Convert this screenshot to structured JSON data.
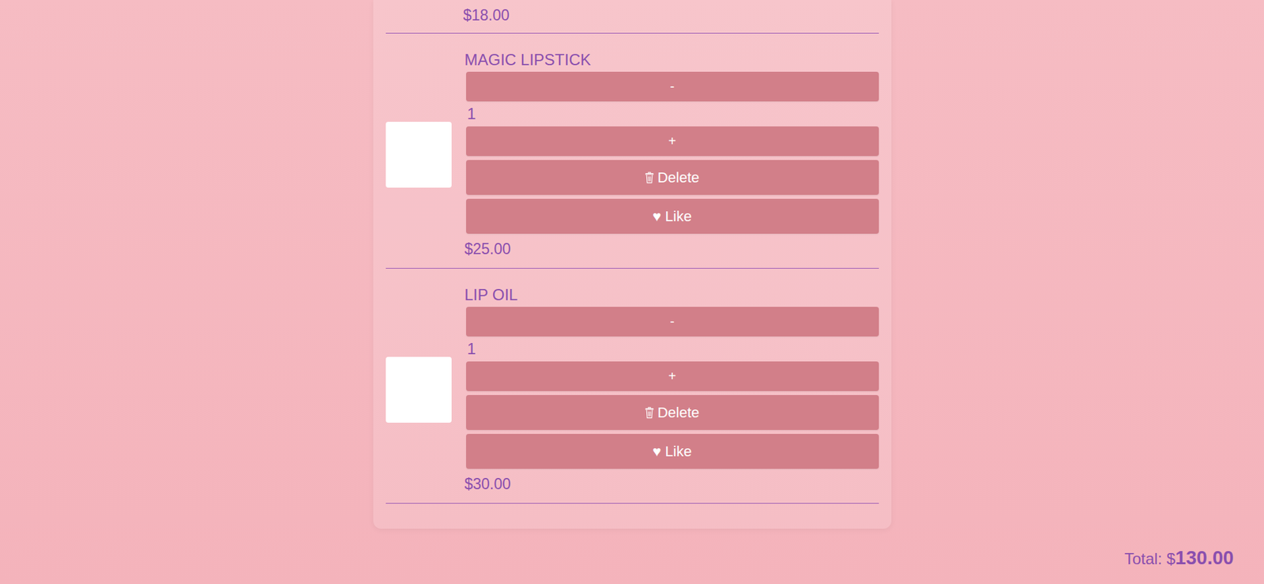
{
  "cart": {
    "partial_item": {
      "price": "$18.00"
    },
    "items": [
      {
        "name": "MAGIC LIPSTICK",
        "decrement": "-",
        "quantity": "1",
        "increment": "+",
        "delete": "Delete",
        "like_icon": "♥",
        "like": "Like",
        "price": "$25.00"
      },
      {
        "name": "LIP OIL",
        "decrement": "-",
        "quantity": "1",
        "increment": "+",
        "delete": "Delete",
        "like_icon": "♥",
        "like": "Like",
        "price": "$30.00"
      }
    ]
  },
  "total": {
    "label": "Total: $",
    "amount": "130.00"
  }
}
